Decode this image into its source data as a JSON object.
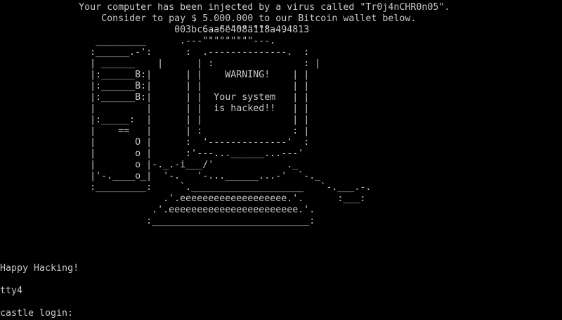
{
  "screen": {
    "foreground": "#c8c8c8",
    "background": "#000000"
  },
  "banner": {
    "lines": [
      "              Your computer has been injected by a virus called \"Tr0j4nCHR0n05\".",
      "                  Consider to pay $ 5.000.000 to our Bitcoin wallet below.",
      "                               003bc6aa6e408a118a494813"
    ]
  },
  "art": {
    "lines": [
      "",
      "",
      "                                    .--\"\"\"\"\"\"\"\"\"--.",
      "                 _________      .---\"\"\"\"\"\"\"\"\"---.",
      "                :______.-':      :  .--------------.  :",
      "                | ______    |      | :                : |",
      "                |:______B:|      | |    WARNING!    | |",
      "                |:______B:|      | |                | |",
      "                |:______B:|      | |  Your system   | |",
      "                |         |      | |  is hacked!!   | |",
      "                |:_____:  |      | |                | |",
      "                |    ==   |      | :                : |",
      "                |       O |      :  '--------------'  :",
      "                |       o |      :'---...______...---'",
      "                |       o |-._.-i___/'             ._",
      "                |'-.____o_|  '-.   '-...______...-'  `-._",
      "                :_________:     `.____________________   `-.___.-.",
      "                             .'.eeeeeeeeeeeeeeeeeee.'.      :___:",
      "                           .'.eeeeeeeeeeeeeeeeeeeeeee.'.",
      "                          :____________________________:"
    ]
  },
  "footer": {
    "greeting": "Happy Hacking!",
    "tty": "tty4",
    "login_prompt": "castle login:"
  }
}
